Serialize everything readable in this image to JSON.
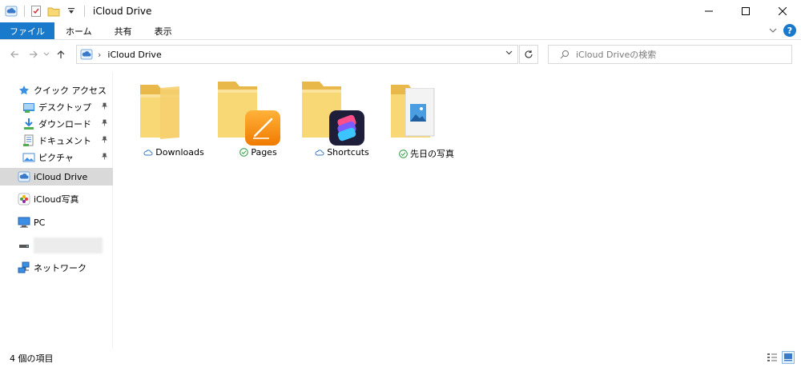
{
  "window": {
    "title": "iCloud Drive"
  },
  "ribbon": {
    "tabs": [
      "ファイル",
      "ホーム",
      "共有",
      "表示"
    ]
  },
  "nav": {
    "breadcrumb": "iCloud Drive",
    "search_placeholder": "iCloud Driveの検索"
  },
  "sidebar": {
    "quick_access": "クイック アクセス",
    "items": [
      {
        "label": "デスクトップ",
        "icon": "desktop-folder-icon",
        "pinned": true
      },
      {
        "label": "ダウンロード",
        "icon": "download-folder-icon",
        "pinned": true
      },
      {
        "label": "ドキュメント",
        "icon": "documents-folder-icon",
        "pinned": true
      },
      {
        "label": "ピクチャ",
        "icon": "pictures-folder-icon",
        "pinned": true
      }
    ],
    "icloud_drive": "iCloud Drive",
    "icloud_photos": "iCloud写真",
    "pc": "PC",
    "network": "ネットワーク"
  },
  "files": [
    {
      "name": "Downloads",
      "status": "cloud",
      "badge": null
    },
    {
      "name": "Pages",
      "status": "synced",
      "badge": "pages-app-icon"
    },
    {
      "name": "Shortcuts",
      "status": "cloud",
      "badge": "shortcuts-app-icon"
    },
    {
      "name": "先日の写真",
      "status": "synced",
      "badge": "photo-file-icon"
    }
  ],
  "status": {
    "item_count": "4 個の項目"
  },
  "colors": {
    "accent": "#1979ca",
    "selected": "#d9d9d9",
    "folder": "#f8d775",
    "folder_dark": "#e8b84a",
    "synced": "#2f9a44",
    "cloud": "#3a7ac8"
  }
}
